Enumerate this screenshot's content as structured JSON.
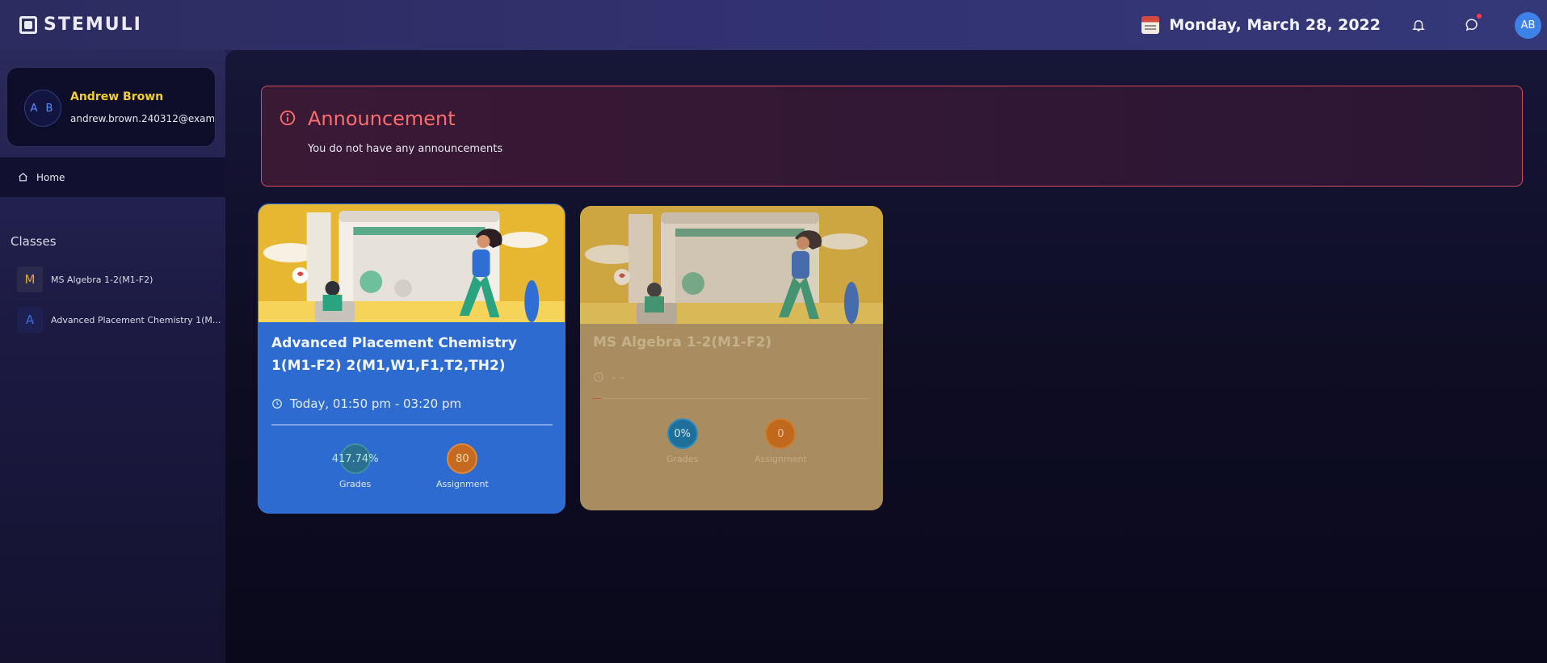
{
  "app": {
    "logo": "STEMULI"
  },
  "header": {
    "date": "Monday, March 28, 2022",
    "avatar_initials": "AB",
    "calendar_icon": "calendar-icon",
    "notification_icon": "bell-icon",
    "chat_icon": "chat-bubble-icon"
  },
  "profile": {
    "initials": "A B",
    "name": "Andrew Brown",
    "email": "andrew.brown.240312@examp..."
  },
  "nav": {
    "home_label": "Home"
  },
  "classes": {
    "title": "Classes",
    "items": [
      {
        "badge": "M",
        "label": "MS Algebra 1-2(M1-F2)",
        "badge_color": "#d9a441"
      },
      {
        "badge": "A",
        "label": "Advanced Placement Chemistry 1(M...",
        "badge_color": "#3f6fe0"
      }
    ]
  },
  "announcement": {
    "title": "Announcement",
    "message": "You do not have any announcements"
  },
  "cards": [
    {
      "title": "Advanced Placement Chemistry 1(M1-F2) 2(M1,W1,F1,T2,TH2)",
      "time": "Today, 01:50 pm - 03:20 pm",
      "grades_value": "417.74%",
      "grades_label": "Grades",
      "assignment_value": "80",
      "assignment_label": "Assignment",
      "color": "#2d6bd1"
    },
    {
      "title": "MS Algebra 1-2(M1-F2)",
      "time": "- -",
      "grades_value": "0%",
      "grades_label": "Grades",
      "assignment_value": "0",
      "assignment_label": "Assignment",
      "color": "#a98d60"
    }
  ]
}
